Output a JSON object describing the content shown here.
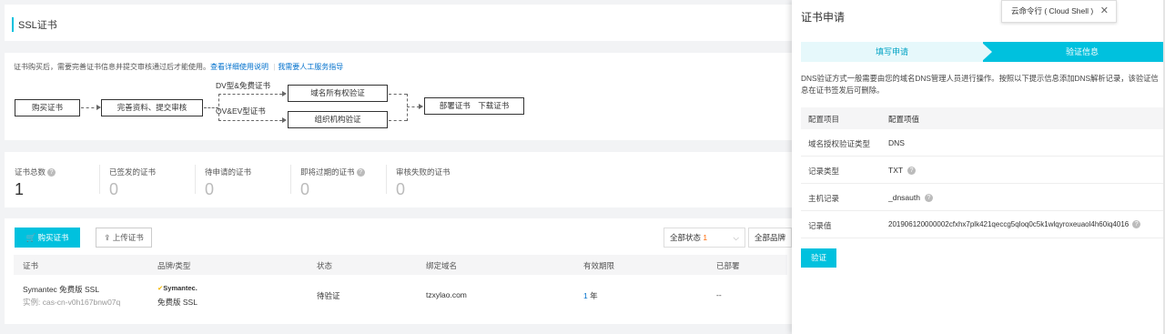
{
  "page": {
    "title": "SSL证书"
  },
  "flow": {
    "note": "证书购买后，需要完善证书信息并提交审核通过后才能使用。",
    "link_doc": "查看详细使用说明",
    "separator": "|",
    "link_help": "我需要人工服务指导",
    "step_buy": "购买证书",
    "step_complete": "完善资料、提交审核",
    "label_dv": "DV型&免费证书",
    "label_ov": "OV&EV型证书",
    "step_domain": "域名所有权验证",
    "step_org": "组织机构验证",
    "step_deploy": "部署证书　下载证书"
  },
  "stats": [
    {
      "label": "证书总数",
      "value": "1",
      "help": true
    },
    {
      "label": "已签发的证书",
      "value": "0",
      "help": false
    },
    {
      "label": "待申请的证书",
      "value": "0",
      "help": false
    },
    {
      "label": "即将过期的证书",
      "value": "0",
      "help": true
    },
    {
      "label": "审核失败的证书",
      "value": "0",
      "help": false
    }
  ],
  "toolbar": {
    "buy_button": "购买证书",
    "upload_button": "上传证书",
    "status_filter_label": "全部状态",
    "status_filter_count": "1",
    "brand_filter_label": "全部品牌"
  },
  "table": {
    "headers": [
      "证书",
      "品牌/类型",
      "状态",
      "绑定域名",
      "有效期限",
      "已部署"
    ],
    "rows": [
      {
        "cert_name": "Symantec 免费版 SSL",
        "instance": "实例: cas-cn-v0h167bnw07q",
        "brand_logo": "Symantec.",
        "brand_type": "免费版 SSL",
        "status": "待验证",
        "domain": "tzxylao.com",
        "validity_num": "1",
        "validity_unit": "年",
        "deployed": "--"
      }
    ]
  },
  "panel": {
    "title": "证书申请",
    "cloud_shell": "云命令行 ( Cloud Shell )",
    "step1": "填写申请",
    "step2": "验证信息",
    "description": "DNS验证方式一般需要由您的域名DNS管理人员进行操作。按照以下提示信息添加DNS解析记录，该验证信息在证书签发后可删除。",
    "config_headers": [
      "配置项目",
      "配置项值"
    ],
    "config_rows": [
      {
        "key": "域名授权验证类型",
        "value": "DNS",
        "help": false
      },
      {
        "key": "记录类型",
        "value": "TXT",
        "help": true
      },
      {
        "key": "主机记录",
        "value": "_dnsauth",
        "help": true
      },
      {
        "key": "记录值",
        "value": "201906120000002cfxhx7plk421qeccg5qloq0c5k1wlqyroxeuaol4h60iq4016",
        "help": true
      }
    ],
    "verify_button": "验证"
  },
  "colors": {
    "accent": "#00c1de",
    "link": "#0070cc",
    "step_light": "#e6f8fb"
  }
}
